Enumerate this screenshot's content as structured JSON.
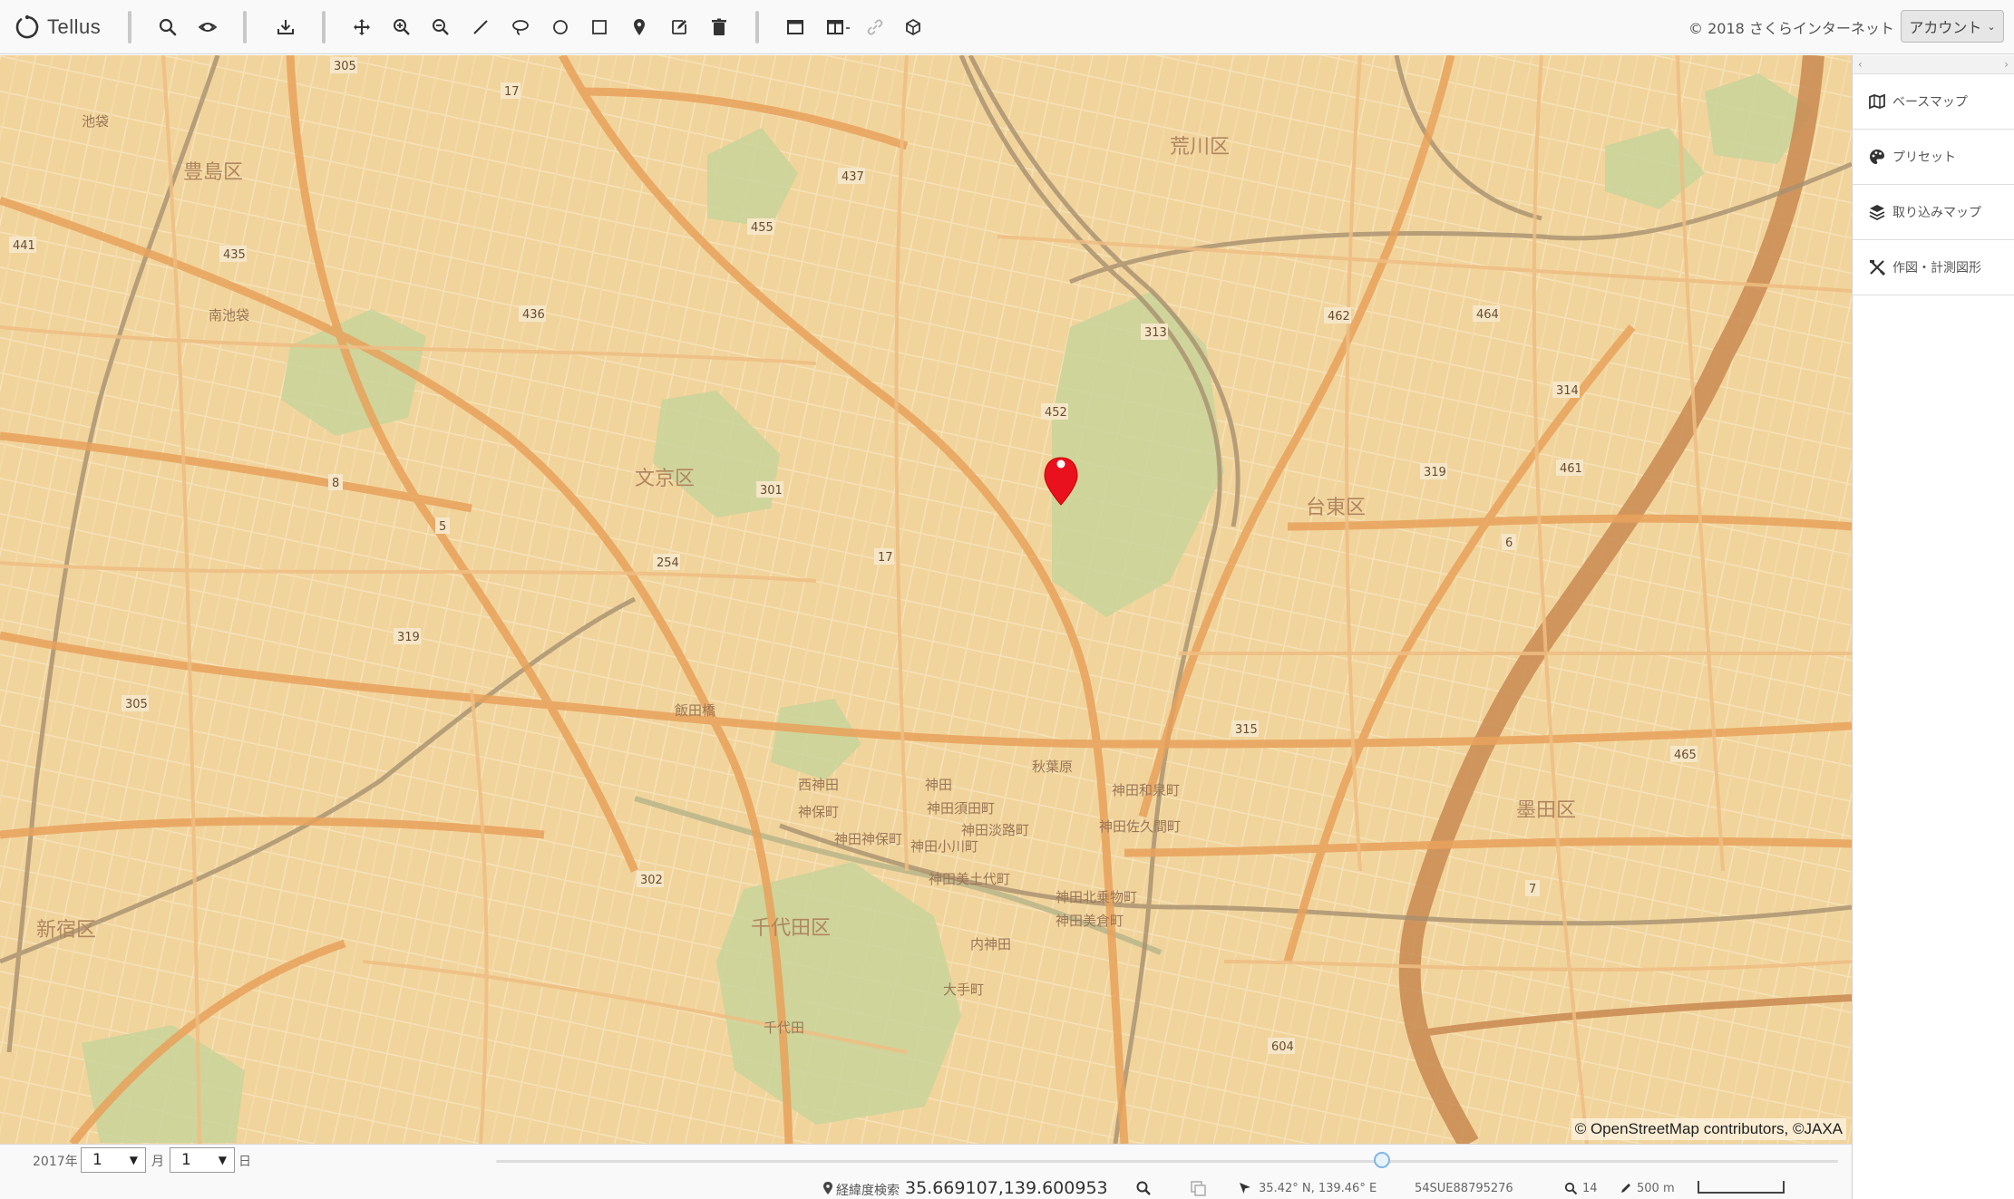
{
  "app": {
    "logo_text": "Tellus"
  },
  "toolbar": {
    "copyright": "© 2018 さくらインターネット",
    "account_label": "アカウント"
  },
  "panel": {
    "items": [
      {
        "label": "ベースマップ",
        "icon": "map-icon"
      },
      {
        "label": "プリセット",
        "icon": "palette-icon"
      },
      {
        "label": "取り込みマップ",
        "icon": "layers-icon"
      },
      {
        "label": "作図・計測図形",
        "icon": "drawing-tools-icon"
      }
    ]
  },
  "map": {
    "attribution": "© OpenStreetMap contributors, ©JAXA",
    "labels": [
      "豊島区",
      "荒川区",
      "文京区",
      "台東区",
      "墨田区",
      "千代田区",
      "新宿区",
      "池袋",
      "南池袋",
      "秋葉原",
      "神田",
      "神田須田町",
      "神田淡路町",
      "神田小川町",
      "神田美土代町",
      "内神田",
      "大手町",
      "千代田",
      "飯田橋",
      "神保町",
      "西神田",
      "神田神保町",
      "神田和泉町",
      "神田佐久間町",
      "神田北乗物町",
      "神田美倉町"
    ],
    "route_numbers": [
      "305",
      "17",
      "437",
      "455",
      "441",
      "436",
      "313",
      "462",
      "464",
      "314",
      "452",
      "301",
      "17",
      "254",
      "319",
      "461",
      "319",
      "6",
      "305",
      "315",
      "465",
      "302",
      "604",
      "7",
      "435",
      "5",
      "8"
    ]
  },
  "bottom": {
    "year": "2017年",
    "month_value": "1",
    "month_unit": "月",
    "day_value": "1",
    "day_unit": "日",
    "geo_label": "経緯度検索",
    "geo_value": "35.669107,139.600953",
    "coord_text": "35.42° N, 139.46° E",
    "grid_code": "54SUE88795276",
    "zoom_level": "14",
    "scale_text": "500 m",
    "timeline_position": 0.66
  },
  "colors": {
    "marker": "#e8111d",
    "map_base": "#f1d49c",
    "road": "#e8a25c",
    "rail": "#a89070",
    "river": "#c98a52"
  }
}
